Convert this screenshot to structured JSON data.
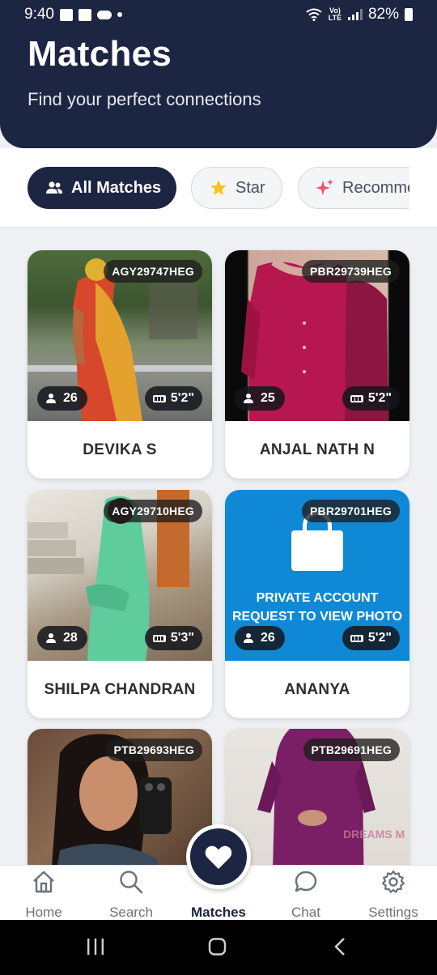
{
  "status_bar": {
    "time": "9:40",
    "network_label": "Vo) LTE",
    "battery": "82%"
  },
  "header": {
    "title": "Matches",
    "subtitle": "Find your perfect connections"
  },
  "filters": [
    {
      "label": "All Matches",
      "icon": "people-icon",
      "active": true
    },
    {
      "label": "Star",
      "icon": "star-icon",
      "active": false
    },
    {
      "label": "Recomme",
      "icon": "sparkle-icon",
      "active": false
    }
  ],
  "cards": [
    {
      "id": "AGY29747HEG",
      "age": "26",
      "height": "5'2\"",
      "name": "DEVIKA S"
    },
    {
      "id": "PBR29739HEG",
      "age": "25",
      "height": "5'2\"",
      "name": "ANJAL NATH N"
    },
    {
      "id": "AGY29710HEG",
      "age": "28",
      "height": "5'3\"",
      "name": "SHILPA CHANDRAN"
    },
    {
      "id": "PBR29701HEG",
      "age": "26",
      "height": "5'2\"",
      "name": "ANANYA",
      "private_line1": "PRIVATE ACCOUNT",
      "private_line2": "REQUEST TO VIEW PHOTO"
    },
    {
      "id": "PTB29693HEG"
    },
    {
      "id": "PTB29691HEG",
      "watermark": "DREAMS M"
    }
  ],
  "bottom_nav": [
    {
      "label": "Home",
      "icon": "home-icon"
    },
    {
      "label": "Search",
      "icon": "search-icon"
    },
    {
      "label": "Matches",
      "icon": "heart-icon",
      "active": true
    },
    {
      "label": "Chat",
      "icon": "chat-icon"
    },
    {
      "label": "Settings",
      "icon": "gear-icon"
    }
  ],
  "colors": {
    "primary": "#1c2541",
    "private_bg": "#0f88d6",
    "star": "#f5c518",
    "sparkle": "#f0506e"
  }
}
